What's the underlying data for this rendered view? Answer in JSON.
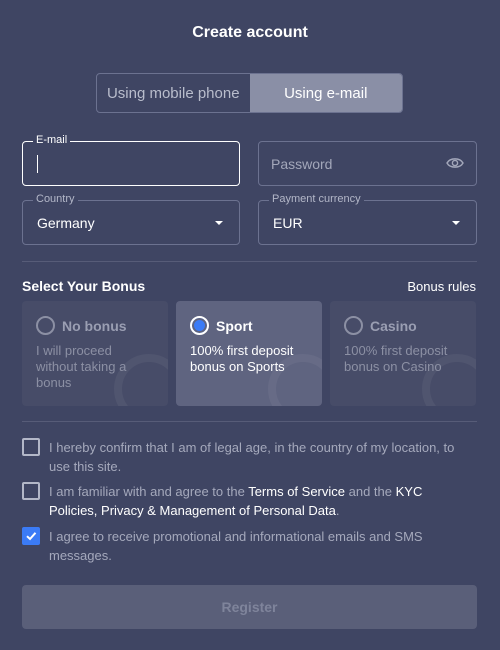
{
  "title": "Create account",
  "tabs": [
    {
      "label": "Using mobile phone",
      "active": false
    },
    {
      "label": "Using e-mail",
      "active": true
    }
  ],
  "fields": {
    "email": {
      "label": "E-mail",
      "value": ""
    },
    "password": {
      "placeholder": "Password"
    },
    "country": {
      "label": "Country",
      "value": "Germany"
    },
    "currency": {
      "label": "Payment currency",
      "value": "EUR"
    }
  },
  "bonus": {
    "section_title": "Select Your Bonus",
    "rules_link": "Bonus rules",
    "options": [
      {
        "name": "No bonus",
        "description": "I will proceed without taking a bonus",
        "selected": false
      },
      {
        "name": "Sport",
        "description": "100% first deposit bonus on Sports",
        "selected": true
      },
      {
        "name": "Casino",
        "description": "100% first deposit bonus on Casino",
        "selected": false
      }
    ]
  },
  "consents": {
    "legal_age": {
      "text": "I hereby confirm that I am of legal age, in the country of my location, to use this site.",
      "checked": false
    },
    "terms": {
      "prefix": "I am familiar with and agree to the ",
      "tos_link": "Terms of Service",
      "middle": " and the ",
      "kyc_link": "KYC Policies, Privacy & Management of Personal Data",
      "suffix": ".",
      "checked": false
    },
    "promo": {
      "text": "I agree to receive promotional and informational emails and SMS messages.",
      "checked": true
    }
  },
  "register_label": "Register",
  "colors": {
    "background": "#3f4563",
    "accent": "#3b7bf6",
    "button_disabled": "#5a5f79"
  }
}
